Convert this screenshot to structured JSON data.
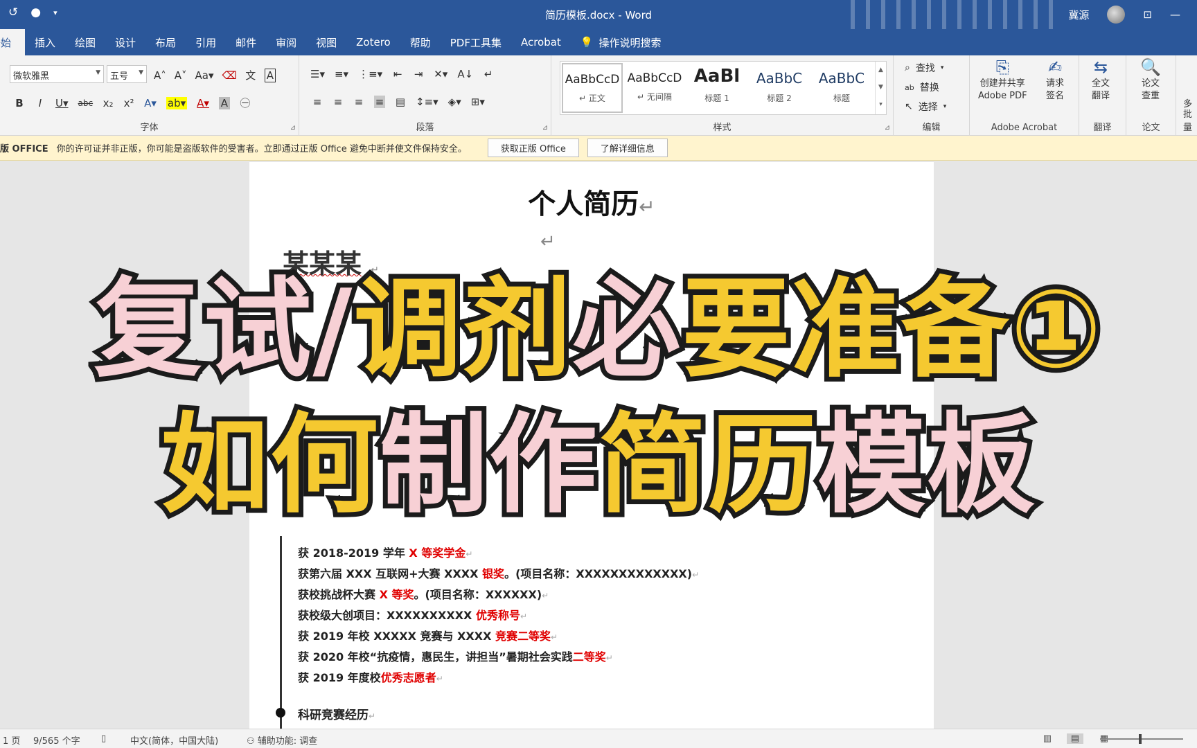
{
  "titlebar": {
    "doc_title": "简历模板.docx - Word",
    "user_name": "冀源",
    "qat_icons": [
      "autosave-icon",
      "undo-icon",
      "customize-icon"
    ]
  },
  "tabs": [
    {
      "label": "开始",
      "active": true
    },
    {
      "label": "插入"
    },
    {
      "label": "绘图"
    },
    {
      "label": "设计"
    },
    {
      "label": "布局"
    },
    {
      "label": "引用"
    },
    {
      "label": "邮件"
    },
    {
      "label": "审阅"
    },
    {
      "label": "视图"
    },
    {
      "label": "Zotero"
    },
    {
      "label": "帮助"
    },
    {
      "label": "PDF工具集"
    },
    {
      "label": "Acrobat"
    }
  ],
  "tell_me": "操作说明搜索",
  "ribbon": {
    "font": {
      "name": "微软雅黑",
      "size": "五号",
      "group_label": "字体"
    },
    "paragraph_label": "段落",
    "styles_label": "样式",
    "styles": [
      {
        "sample": "AaBbCcD",
        "name": "正文"
      },
      {
        "sample": "AaBbCcD",
        "name": "无间隔"
      },
      {
        "sample": "AaBl",
        "name": "标题 1"
      },
      {
        "sample": "AaBbC",
        "name": "标题 2"
      },
      {
        "sample": "AaBbC",
        "name": "标题"
      }
    ],
    "editing": {
      "find": "查找",
      "replace": "替换",
      "select": "选择",
      "label": "编辑"
    },
    "acrobat": {
      "create_share": "创建并共享",
      "adobe_pdf": "Adobe PDF",
      "request": "请求",
      "sign": "签名",
      "label": "Adobe Acrobat"
    },
    "translate": {
      "full": "全文",
      "translate": "翻译",
      "label": "翻译"
    },
    "paper": {
      "paper": "论文",
      "check": "查重",
      "label": "论文"
    },
    "more": {
      "top": "多",
      "label": "批量"
    }
  },
  "warning": {
    "title": "版 OFFICE",
    "message": "你的许可证并非正版，你可能是盗版软件的受害者。立即通过正版 Office 避免中断并使文件保持安全。",
    "btn_get": "获取正版 Office",
    "btn_learn": "了解详细信息"
  },
  "document": {
    "heading": "个人简历",
    "name": "某某某",
    "awards": [
      {
        "pre": "获 2018-2019 学年 ",
        "hl": "X 等奖学金",
        "post": ""
      },
      {
        "pre": "获第六届 XXX 互联网+大赛 XXXX ",
        "hl": "银奖",
        "post": "。(项目名称：XXXXXXXXXXXXX)"
      },
      {
        "pre": "获校挑战杯大赛 ",
        "hl": "X 等奖",
        "post": "。(项目名称：XXXXXX)"
      },
      {
        "pre": "获校级大创项目：XXXXXXXXXX ",
        "hl": "优秀称号",
        "post": ""
      },
      {
        "pre": "获 2019 年校 XXXXX 竞赛与 XXXX ",
        "hl": "竞赛二等奖",
        "post": ""
      },
      {
        "pre": "获 2020 年校“抗疫情，惠民生，讲担当”暑期社会实践",
        "hl": "二等奖",
        "post": ""
      },
      {
        "pre": "获 2019 年度校",
        "hl": "优秀志愿者",
        "post": ""
      }
    ],
    "section": "科研竞赛经历"
  },
  "overlay": {
    "line1_a": "复试/",
    "line1_b": "调剂",
    "line1_c": "必",
    "line1_d": "要准备①",
    "line2_a": "如何",
    "line2_b": "制作",
    "line2_c": "简历",
    "line2_d": "模板"
  },
  "status": {
    "page": "1 页",
    "words": "9/565 个字",
    "lang": "中文(简体，中国大陆)",
    "accessibility": "辅助功能: 调查"
  },
  "colors": {
    "word_blue": "#2b579a",
    "overlay_pink": "#f7d0d5",
    "overlay_yellow": "#f5c930",
    "award_red": "#e00000"
  }
}
